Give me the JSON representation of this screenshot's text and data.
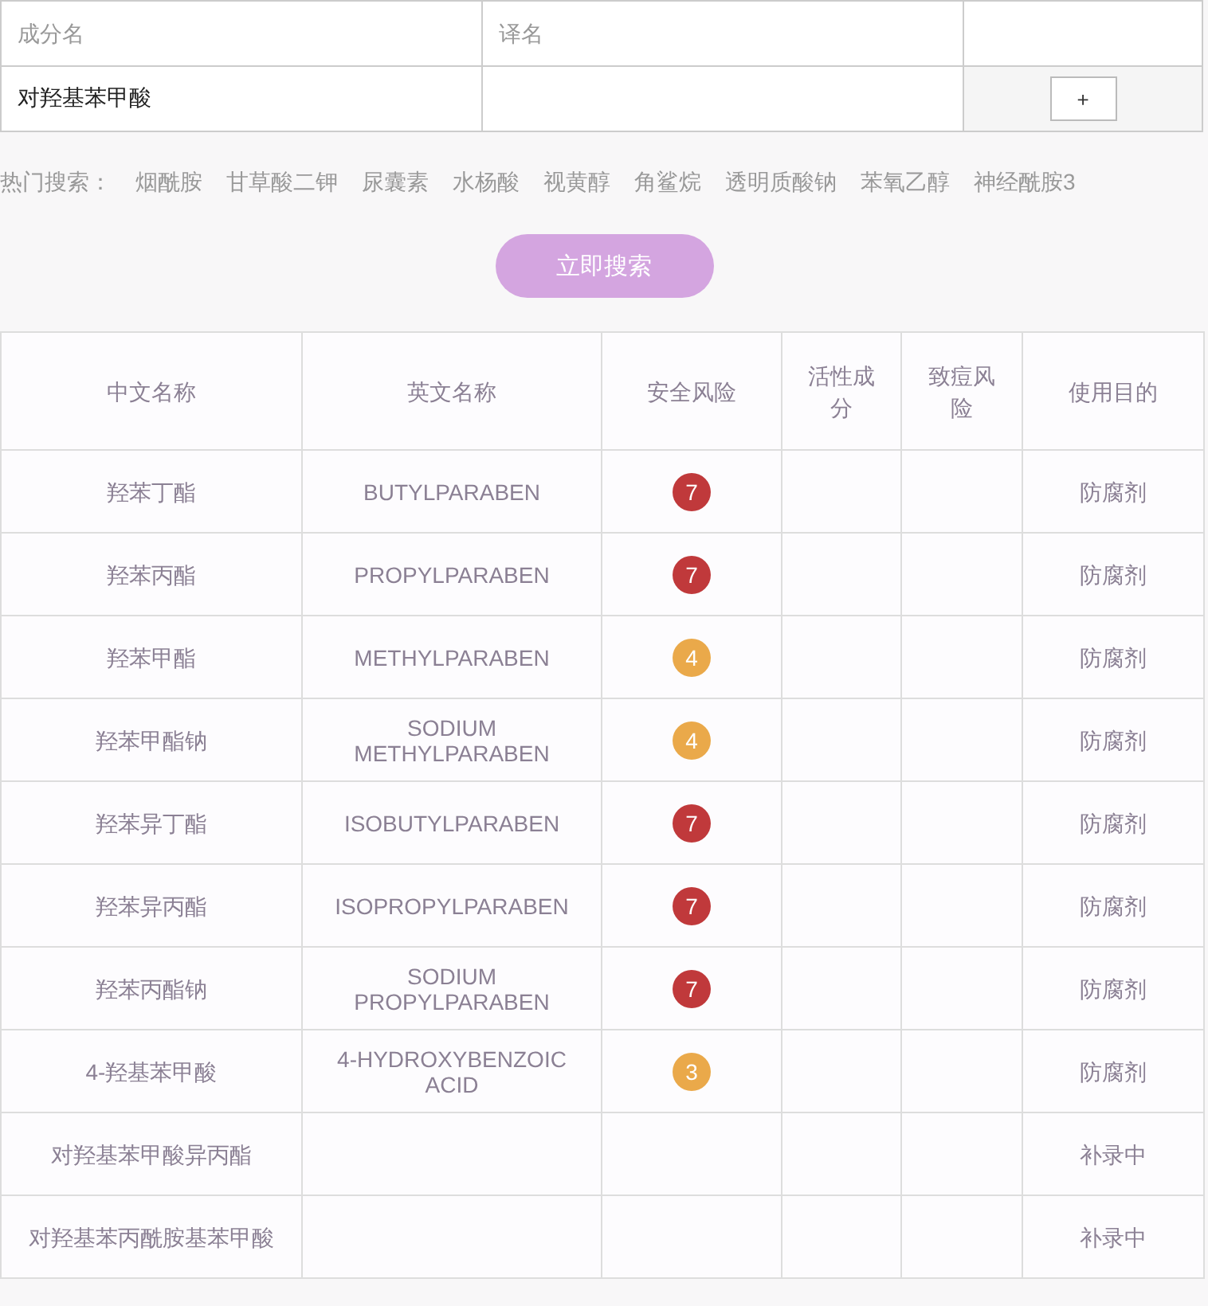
{
  "form": {
    "columns": [
      {
        "placeholder": "成分名"
      },
      {
        "placeholder": "译名"
      }
    ],
    "entries": [
      {
        "name": "对羟基苯甲酸"
      }
    ],
    "add_button": "+"
  },
  "hot_search": {
    "label": "热门搜索：",
    "terms": [
      "烟酰胺",
      "甘草酸二钾",
      "尿囊素",
      "水杨酸",
      "视黄醇",
      "角鲨烷",
      "透明质酸钠",
      "苯氧乙醇",
      "神经酰胺3"
    ]
  },
  "search_button": "立即搜索",
  "table": {
    "columns": [
      "中文名称",
      "英文名称",
      "安全风险",
      "活性成分",
      "致痘风险",
      "使用目的"
    ],
    "rows": [
      {
        "cn": "羟苯丁酯",
        "en": "BUTYLPARABEN",
        "risk": "7",
        "color": "#c0393b",
        "purpose": "防腐剂"
      },
      {
        "cn": "羟苯丙酯",
        "en": "PROPYLPARABEN",
        "risk": "7",
        "color": "#c0393b",
        "purpose": "防腐剂"
      },
      {
        "cn": "羟苯甲酯",
        "en": "METHYLPARABEN",
        "risk": "4",
        "color": "#eaa94a",
        "purpose": "防腐剂"
      },
      {
        "cn": "羟苯甲酯钠",
        "en": "SODIUM METHYLPARABEN",
        "risk": "4",
        "color": "#eaa94a",
        "purpose": "防腐剂"
      },
      {
        "cn": "羟苯异丁酯",
        "en": "ISOBUTYLPARABEN",
        "risk": "7",
        "color": "#c0393b",
        "purpose": "防腐剂"
      },
      {
        "cn": "羟苯异丙酯",
        "en": "ISOPROPYLPARABEN",
        "risk": "7",
        "color": "#c0393b",
        "purpose": "防腐剂"
      },
      {
        "cn": "羟苯丙酯钠",
        "en": "SODIUM PROPYLPARABEN",
        "risk": "7",
        "color": "#c0393b",
        "purpose": "防腐剂"
      },
      {
        "cn": "4-羟基苯甲酸",
        "en": "4-HYDROXYBENZOIC ACID",
        "risk": "3",
        "color": "#eaa94a",
        "purpose": "防腐剂"
      },
      {
        "cn": "对羟基苯甲酸异丙酯",
        "purpose": "补录中"
      },
      {
        "cn": "对羟基苯丙酰胺基苯甲酸",
        "purpose": "补录中"
      }
    ]
  }
}
